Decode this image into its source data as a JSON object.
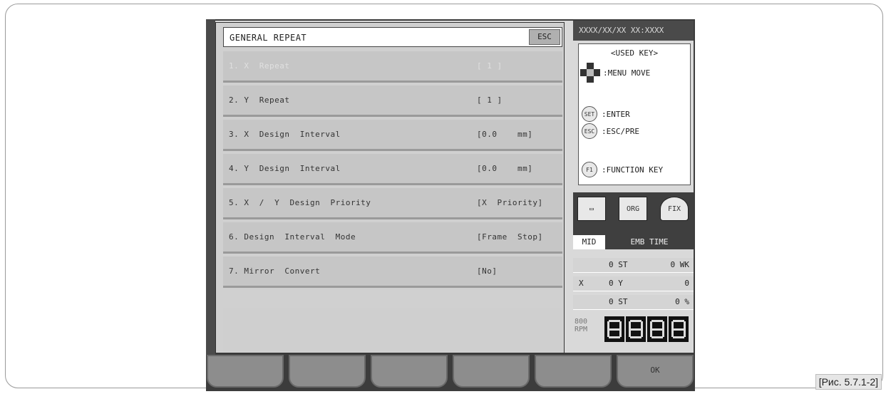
{
  "caption": "[Рис. 5.7.1-2]",
  "dialog": {
    "title": "GENERAL  REPEAT",
    "esc_label": "ESC",
    "items": [
      {
        "label": "1. X  Repeat",
        "value": "[ 1 ]",
        "state": "disabled"
      },
      {
        "label": "2. Y  Repeat",
        "value": "[ 1 ]",
        "state": "normal"
      },
      {
        "label": "3. X  Design  Interval",
        "value": "[0.0    mm]",
        "state": "normal"
      },
      {
        "label": "4. Y  Design  Interval",
        "value": "[0.0    mm]",
        "state": "normal"
      },
      {
        "label": "5. X  /  Y  Design  Priority",
        "value": "[X  Priority]",
        "state": "normal"
      },
      {
        "label": "6. Design  Interval  Mode",
        "value": "[Frame  Stop]",
        "state": "normal"
      },
      {
        "label": "7. Mirror  Convert",
        "value": "[No]",
        "state": "normal"
      }
    ]
  },
  "right_panel": {
    "datetime": "XXXX/XX/XX XX:XXXX",
    "used_key_title": "<USED  KEY>",
    "keys": [
      {
        "icon": "dpad-icon",
        "label": ":MENU  MOVE"
      },
      {
        "icon": "set-key-icon",
        "key": "SET",
        "label": ":ENTER"
      },
      {
        "icon": "esc-key-icon",
        "key": "ESC",
        "label": ":ESC/PRE"
      },
      {
        "icon": "f1-key-icon",
        "key": "F1",
        "label": ":FUNCTION  KEY"
      }
    ],
    "icons": {
      "org": "ORG",
      "fix": "FIX"
    },
    "tabs": {
      "mid": "MID",
      "emb": "EMB  TIME"
    },
    "stats": [
      {
        "a": "",
        "b": "0 ST",
        "c": "0 WK"
      },
      {
        "a": "X",
        "b": "0 Y",
        "c": "0"
      },
      {
        "a": "",
        "b": "0 ST",
        "c": "0 %"
      }
    ],
    "rpm": {
      "value": "800",
      "unit": "RPM"
    }
  },
  "function_keys": [
    "",
    "",
    "",
    "",
    "",
    "OK"
  ]
}
